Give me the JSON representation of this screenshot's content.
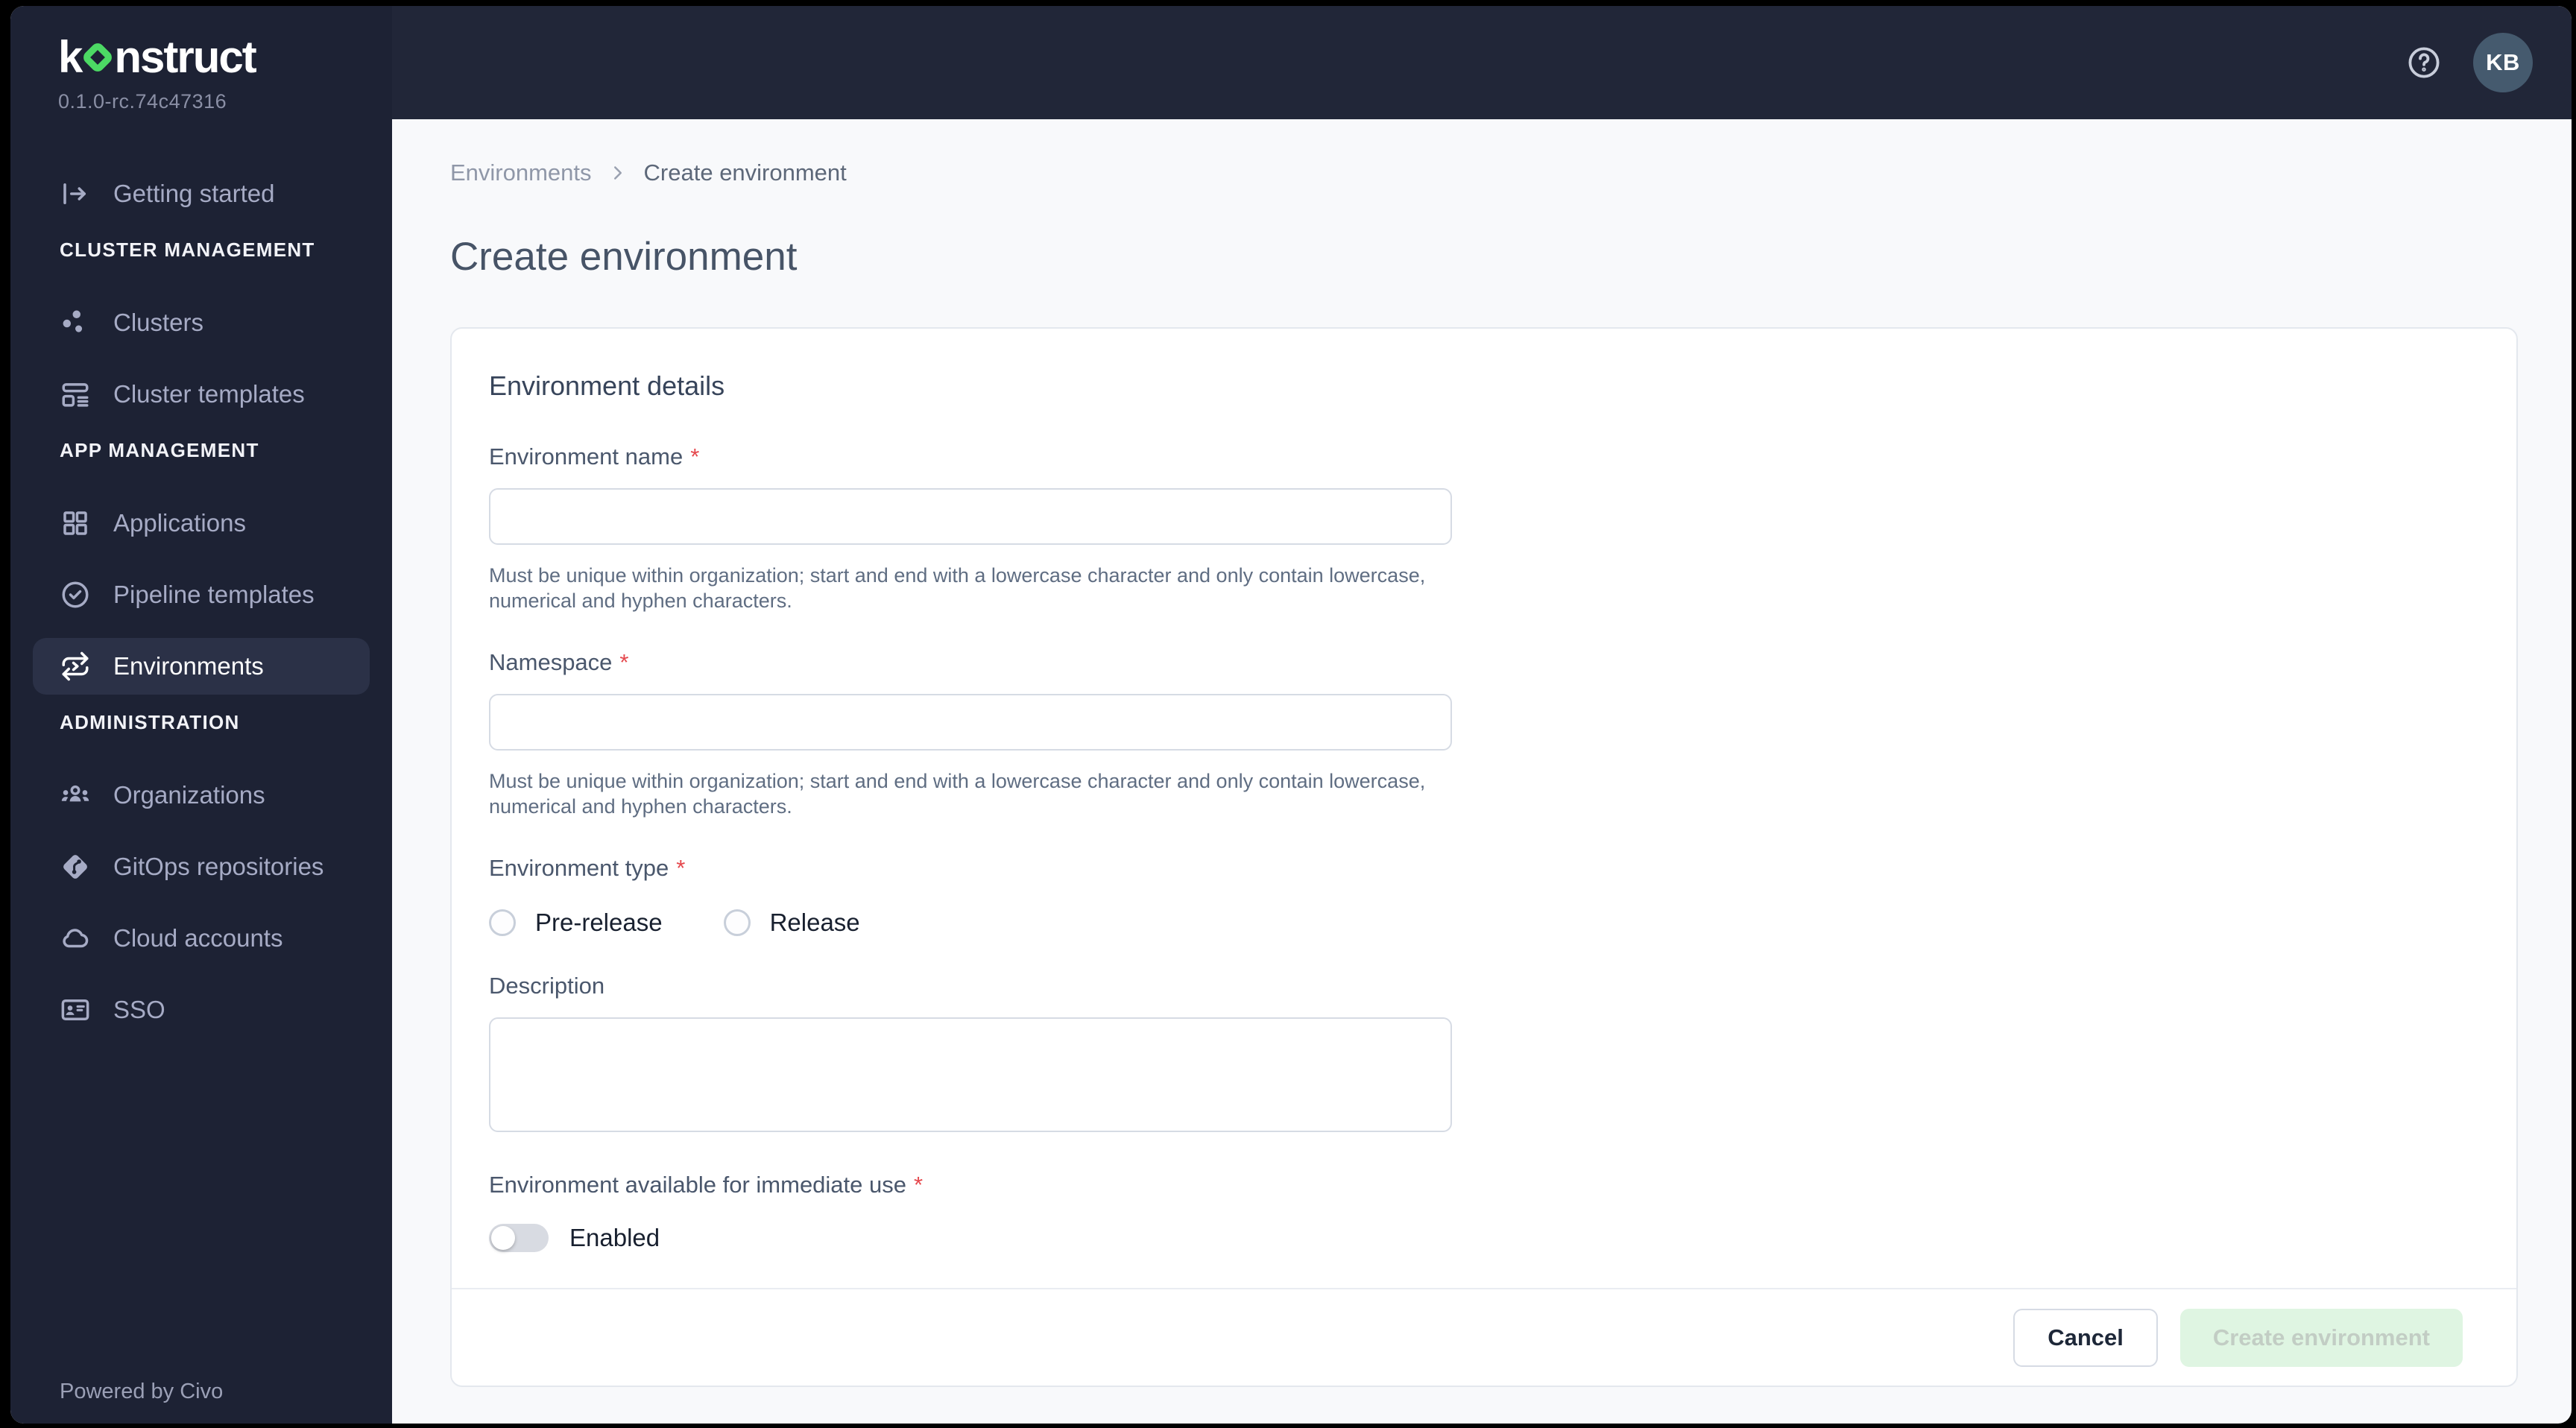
{
  "app": {
    "logo_pre": "k",
    "logo_post": "nstruct",
    "version": "0.1.0-rc.74c47316",
    "powered_by": "Powered by Civo"
  },
  "topbar": {
    "avatar_initials": "KB"
  },
  "sidebar": {
    "getting_started": {
      "label": "Getting started",
      "icon": "getting-started-icon"
    },
    "sections": [
      {
        "header": "CLUSTER MANAGEMENT",
        "items": [
          {
            "label": "Clusters",
            "icon": "clusters-icon",
            "active": false
          },
          {
            "label": "Cluster templates",
            "icon": "cluster-templates-icon",
            "active": false
          }
        ]
      },
      {
        "header": "APP MANAGEMENT",
        "items": [
          {
            "label": "Applications",
            "icon": "applications-icon",
            "active": false
          },
          {
            "label": "Pipeline templates",
            "icon": "pipeline-templates-icon",
            "active": false
          },
          {
            "label": "Environments",
            "icon": "environments-icon",
            "active": true
          }
        ]
      },
      {
        "header": "ADMINISTRATION",
        "items": [
          {
            "label": "Organizations",
            "icon": "organizations-icon",
            "active": false
          },
          {
            "label": "GitOps repositories",
            "icon": "gitops-icon",
            "active": false
          },
          {
            "label": "Cloud accounts",
            "icon": "cloud-icon",
            "active": false
          },
          {
            "label": "SSO",
            "icon": "sso-icon",
            "active": false
          }
        ]
      }
    ]
  },
  "breadcrumb": {
    "parent": "Environments",
    "current": "Create environment"
  },
  "page": {
    "title": "Create environment"
  },
  "form": {
    "card_title": "Environment details",
    "required_marker": "*",
    "fields": {
      "environment_name": {
        "label": "Environment name",
        "required": true,
        "value": "",
        "help": "Must be unique within organization; start and end with a lowercase character and only contain lowercase, numerical and hyphen characters."
      },
      "namespace": {
        "label": "Namespace",
        "required": true,
        "value": "",
        "help": "Must be unique within organization; start and end with a lowercase character and only contain lowercase, numerical and hyphen characters."
      },
      "environment_type": {
        "label": "Environment type",
        "required": true,
        "options": [
          {
            "label": "Pre-release",
            "checked": false
          },
          {
            "label": "Release",
            "checked": false
          }
        ]
      },
      "description": {
        "label": "Description",
        "value": ""
      },
      "immediate_use": {
        "label": "Environment available for immediate use",
        "required": true,
        "toggle_label": "Enabled",
        "enabled": false
      }
    },
    "actions": {
      "cancel": "Cancel",
      "submit": "Create environment",
      "submit_disabled": true
    }
  },
  "colors": {
    "accent_green": "#4cd964",
    "sidebar_bg": "#1d2234",
    "topbar_bg": "#212638",
    "avatar_bg": "#455a6e",
    "required_red": "#e5484d",
    "disabled_submit_bg": "#dff5e2",
    "disabled_submit_text": "#c2cdc4"
  }
}
